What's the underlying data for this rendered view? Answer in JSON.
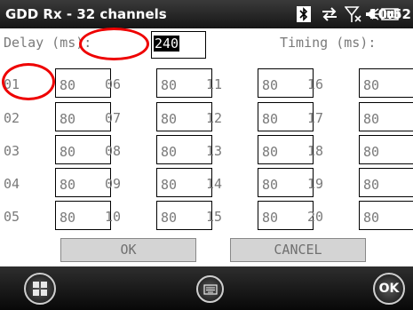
{
  "titlebar": {
    "title": "GDD Rx - 32 channels",
    "clock": "10:52",
    "icons": [
      "bluetooth-icon",
      "data-sync-icon",
      "signal-icon",
      "volume-icon",
      "battery-icon"
    ]
  },
  "form": {
    "delay_label": "Delay (ms):",
    "delay_value": "240",
    "timing_label": "Timing (ms):",
    "channels": [
      {
        "num": "01",
        "value": "80"
      },
      {
        "num": "02",
        "value": "80"
      },
      {
        "num": "03",
        "value": "80"
      },
      {
        "num": "04",
        "value": "80"
      },
      {
        "num": "05",
        "value": "80"
      },
      {
        "num": "06",
        "value": "80"
      },
      {
        "num": "07",
        "value": "80"
      },
      {
        "num": "08",
        "value": "80"
      },
      {
        "num": "09",
        "value": "80"
      },
      {
        "num": "10",
        "value": "80"
      },
      {
        "num": "11",
        "value": "80"
      },
      {
        "num": "12",
        "value": "80"
      },
      {
        "num": "13",
        "value": "80"
      },
      {
        "num": "14",
        "value": "80"
      },
      {
        "num": "15",
        "value": "80"
      },
      {
        "num": "16",
        "value": "80"
      },
      {
        "num": "17",
        "value": "80"
      },
      {
        "num": "18",
        "value": "80"
      },
      {
        "num": "19",
        "value": "80"
      },
      {
        "num": "20",
        "value": "80"
      }
    ],
    "ok_label": "OK",
    "cancel_label": "CANCEL"
  },
  "taskbar": {
    "ok_label": "OK"
  },
  "colors": {
    "highlight_ring": "#e00000",
    "titlebar_bg": "#1e1e1e",
    "text_gray": "#7a7a7a"
  }
}
